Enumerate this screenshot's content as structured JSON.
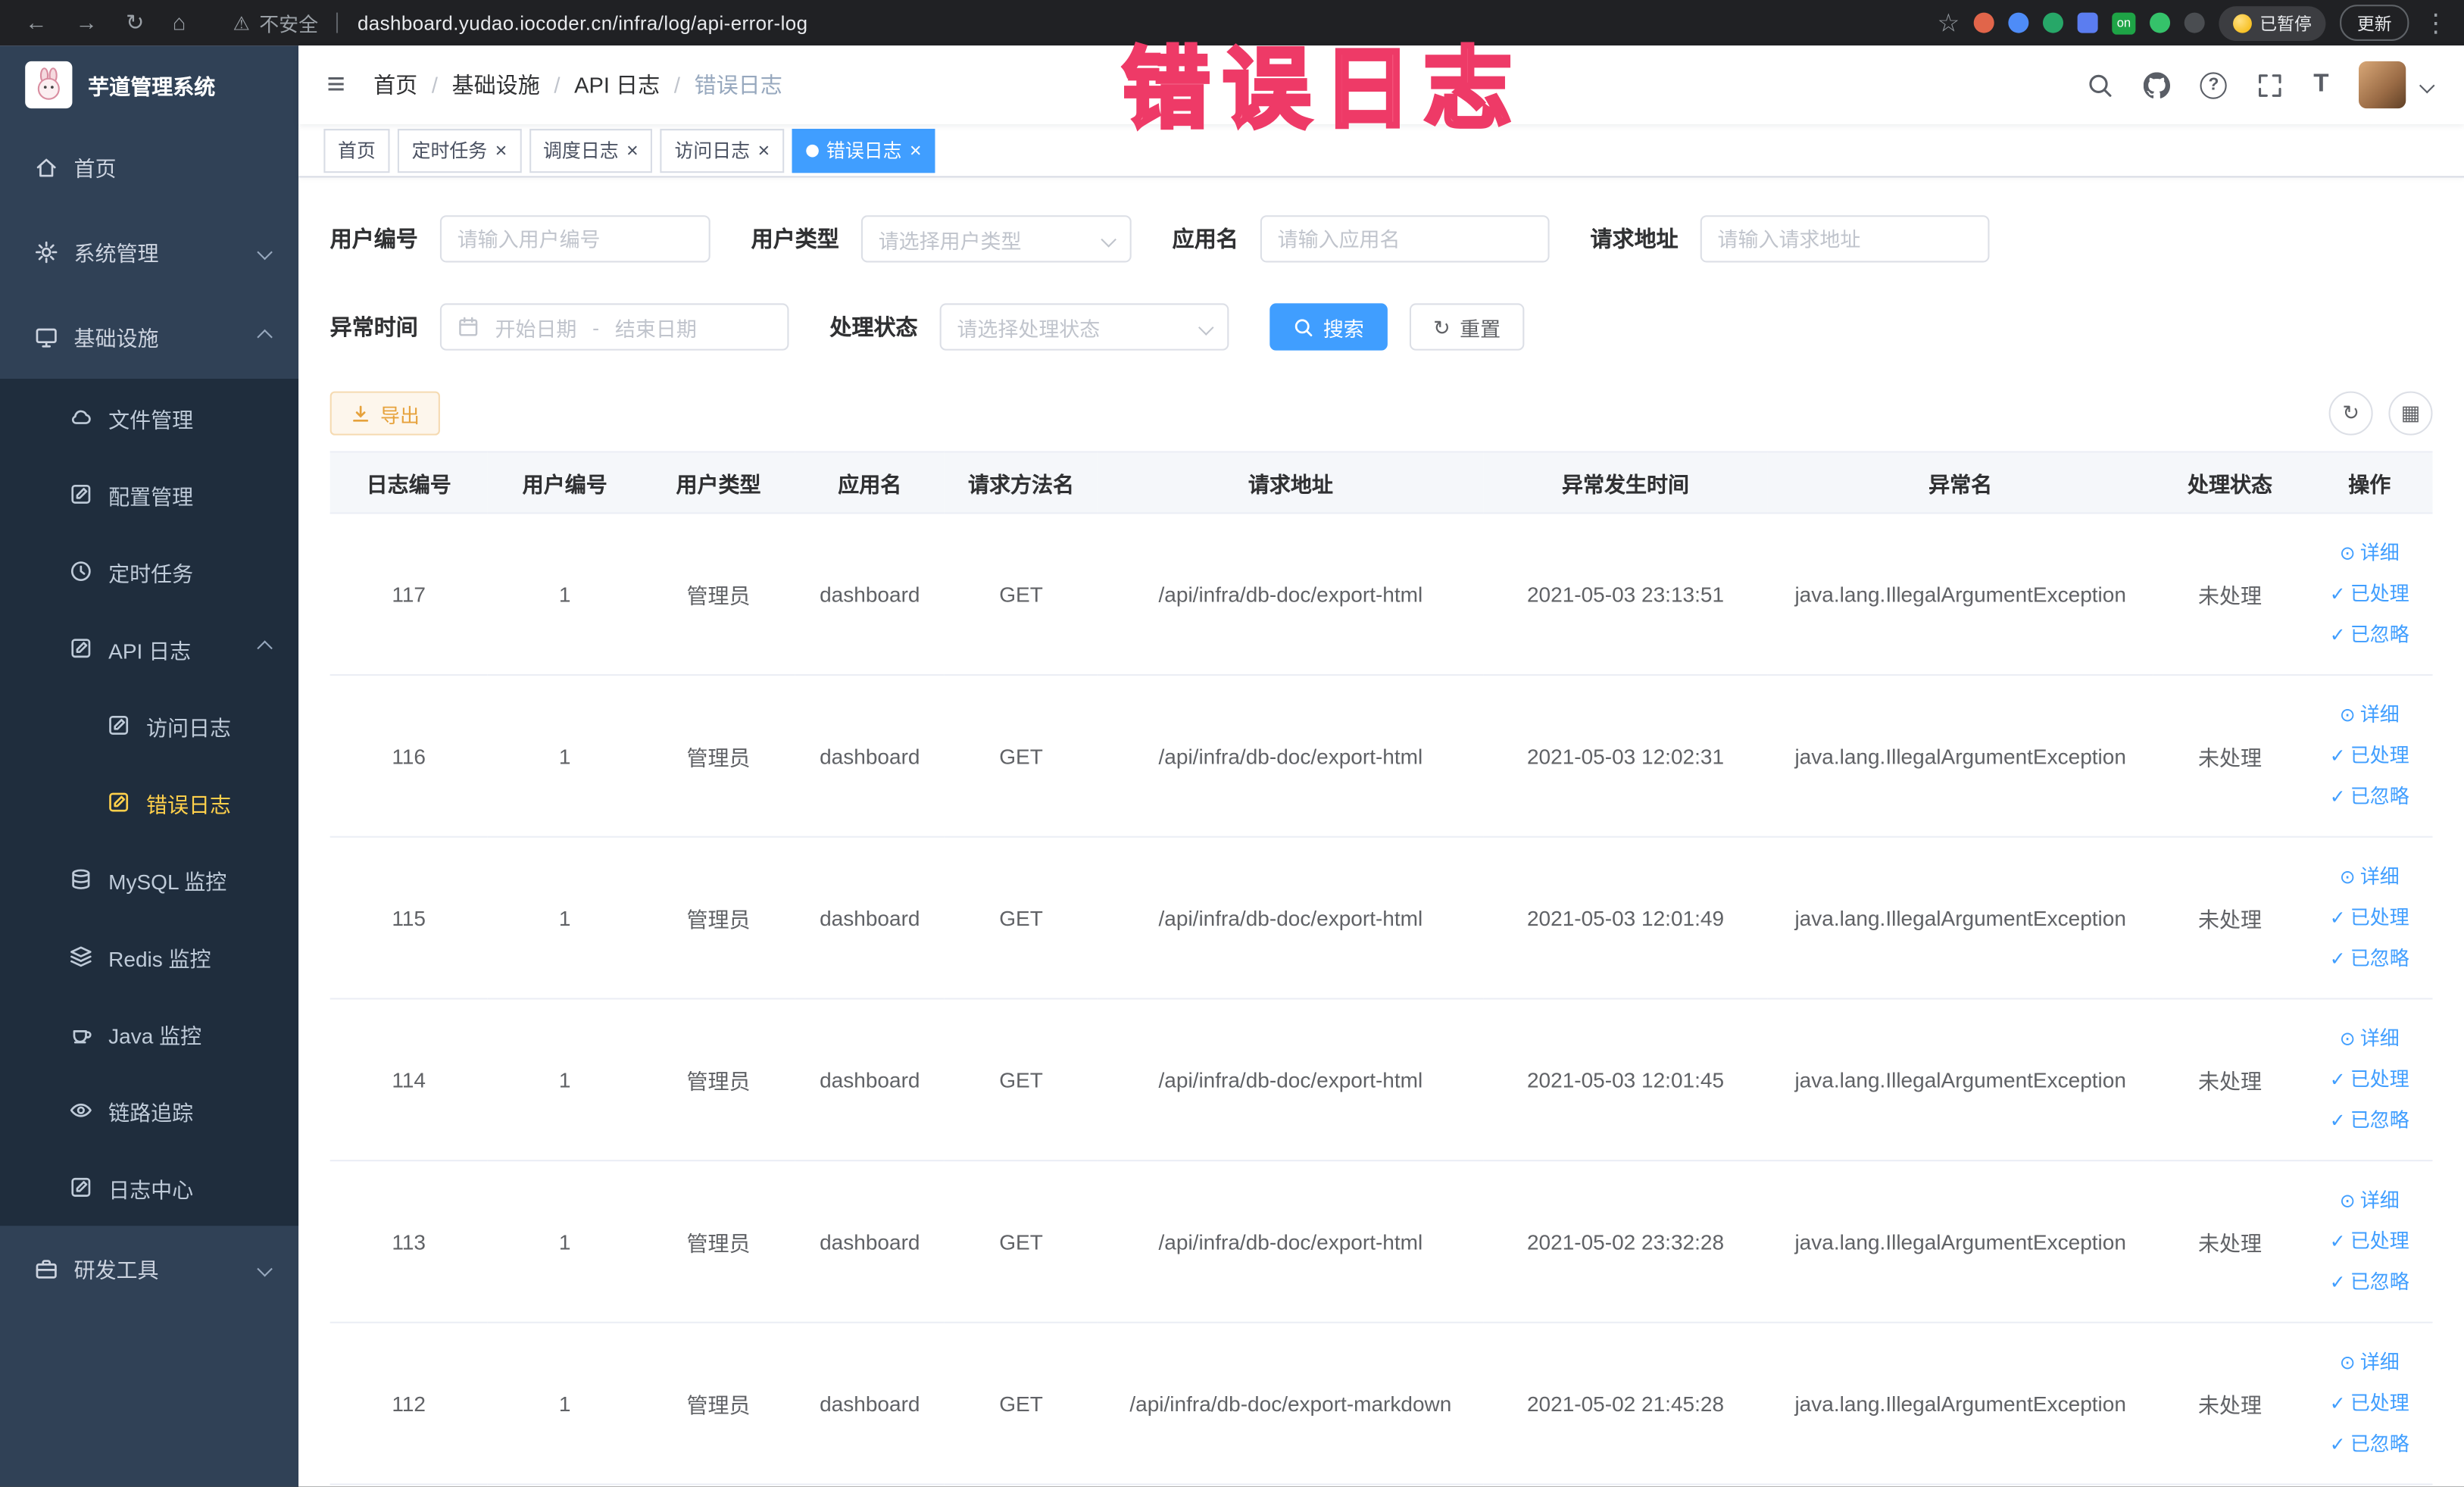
{
  "watermark": "错误日志",
  "browser": {
    "security_label": "不安全",
    "url": "dashboard.yudao.iocoder.cn/infra/log/api-error-log",
    "paused_badge": "已暂停",
    "update_label": "更新"
  },
  "icons": {
    "back": "←",
    "forward": "→",
    "reload": "↻",
    "home": "⌂",
    "warning": "⚠",
    "star": "☆",
    "kebab": "⋮",
    "ext_on": "on",
    "hamburger": "≡",
    "question": "?",
    "fontsize": "T",
    "close": "×",
    "refresh": "↻",
    "columns": "▦",
    "view": "⊙",
    "check": "✓",
    "crumb_sep": "/"
  },
  "sidebar": {
    "logo_title": "芋道管理系统",
    "items": [
      {
        "label": "首页"
      },
      {
        "label": "系统管理"
      },
      {
        "label": "基础设施"
      },
      {
        "label": "文件管理"
      },
      {
        "label": "配置管理"
      },
      {
        "label": "定时任务"
      },
      {
        "label": "API 日志"
      },
      {
        "label": "访问日志"
      },
      {
        "label": "错误日志"
      },
      {
        "label": "MySQL 监控"
      },
      {
        "label": "Redis 监控"
      },
      {
        "label": "Java 监控"
      },
      {
        "label": "链路追踪"
      },
      {
        "label": "日志中心"
      },
      {
        "label": "研发工具"
      }
    ]
  },
  "header": {
    "breadcrumbs": [
      "首页",
      "基础设施",
      "API 日志",
      "错误日志"
    ]
  },
  "tabs": [
    {
      "label": "首页"
    },
    {
      "label": "定时任务"
    },
    {
      "label": "调度日志"
    },
    {
      "label": "访问日志"
    },
    {
      "label": "错误日志"
    }
  ],
  "filters": {
    "user_id": {
      "label": "用户编号",
      "placeholder": "请输入用户编号"
    },
    "user_type": {
      "label": "用户类型",
      "placeholder": "请选择用户类型"
    },
    "app_name": {
      "label": "应用名",
      "placeholder": "请输入应用名"
    },
    "request_url": {
      "label": "请求地址",
      "placeholder": "请输入请求地址"
    },
    "exception_time": {
      "label": "异常时间",
      "start_placeholder": "开始日期",
      "separator": "-",
      "end_placeholder": "结束日期"
    },
    "process_status": {
      "label": "处理状态",
      "placeholder": "请选择处理状态"
    },
    "search_button": "搜索",
    "reset_button": "重置"
  },
  "toolbar": {
    "export_label": "导出"
  },
  "table": {
    "columns": [
      "日志编号",
      "用户编号",
      "用户类型",
      "应用名",
      "请求方法名",
      "请求地址",
      "异常发生时间",
      "异常名",
      "处理状态",
      "操作"
    ],
    "actions": {
      "detail": "详细",
      "processed": "已处理",
      "ignored": "已忽略"
    },
    "rows": [
      {
        "log_id": "117",
        "user_id": "1",
        "user_type": "管理员",
        "app_name": "dashboard",
        "method": "GET",
        "url": "/api/infra/db-doc/export-html",
        "time": "2021-05-03 23:13:51",
        "exception": "java.lang.IllegalArgumentException",
        "status": "未处理"
      },
      {
        "log_id": "116",
        "user_id": "1",
        "user_type": "管理员",
        "app_name": "dashboard",
        "method": "GET",
        "url": "/api/infra/db-doc/export-html",
        "time": "2021-05-03 12:02:31",
        "exception": "java.lang.IllegalArgumentException",
        "status": "未处理"
      },
      {
        "log_id": "115",
        "user_id": "1",
        "user_type": "管理员",
        "app_name": "dashboard",
        "method": "GET",
        "url": "/api/infra/db-doc/export-html",
        "time": "2021-05-03 12:01:49",
        "exception": "java.lang.IllegalArgumentException",
        "status": "未处理"
      },
      {
        "log_id": "114",
        "user_id": "1",
        "user_type": "管理员",
        "app_name": "dashboard",
        "method": "GET",
        "url": "/api/infra/db-doc/export-html",
        "time": "2021-05-03 12:01:45",
        "exception": "java.lang.IllegalArgumentException",
        "status": "未处理"
      },
      {
        "log_id": "113",
        "user_id": "1",
        "user_type": "管理员",
        "app_name": "dashboard",
        "method": "GET",
        "url": "/api/infra/db-doc/export-html",
        "time": "2021-05-02 23:32:28",
        "exception": "java.lang.IllegalArgumentException",
        "status": "未处理"
      },
      {
        "log_id": "112",
        "user_id": "1",
        "user_type": "管理员",
        "app_name": "dashboard",
        "method": "GET",
        "url": "/api/infra/db-doc/export-markdown",
        "time": "2021-05-02 21:45:28",
        "exception": "java.lang.IllegalArgumentException",
        "status": "未处理"
      }
    ]
  },
  "colors": {
    "accent": "#409eff",
    "sidebar_bg": "#304156",
    "submenu_bg": "#1f2d3d",
    "active_menu_text": "#ffd04b",
    "warning": "#e6a23c",
    "watermark_pink": "#ee3a67"
  }
}
